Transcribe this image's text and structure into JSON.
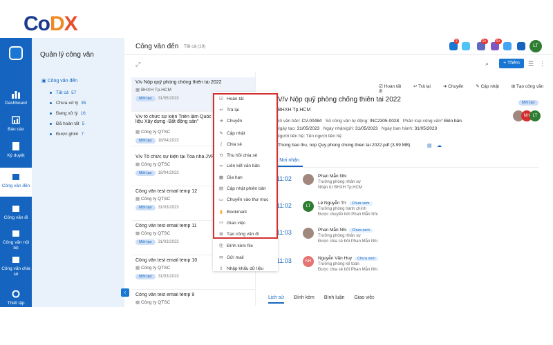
{
  "logo": {
    "c": "C",
    "o": "o",
    "d": "D",
    "x": "X"
  },
  "rail": {
    "items": [
      {
        "label": "Dashboard"
      },
      {
        "label": "Báo cáo"
      },
      {
        "label": "Ký duyệt"
      },
      {
        "label": "Công văn đến"
      },
      {
        "label": "Công văn đi"
      },
      {
        "label": "Công văn nội bộ"
      },
      {
        "label": "Công văn chia sẻ"
      },
      {
        "label": "Thiết lập"
      }
    ]
  },
  "nav": {
    "title": "Quản lý công văn",
    "group": "Công văn đến",
    "subs": [
      {
        "label": "Tất cả",
        "count": "57"
      },
      {
        "label": "Chưa xử lý",
        "count": "35"
      },
      {
        "label": "Đang xử lý",
        "count": "16"
      },
      {
        "label": "Đã hoàn tất",
        "count": "5"
      },
      {
        "label": "Được ghim",
        "count": "7"
      }
    ]
  },
  "header": {
    "title": "Công văn đến",
    "count": "Tất cả (19)",
    "badges": [
      "2",
      "9+",
      "9+"
    ],
    "avatar": "LT",
    "add_label": "+ Thêm"
  },
  "list": [
    {
      "title": "V/v Nộp quỹ phòng chống thiên tai 2022",
      "org": "BHXH Tp.HCM",
      "status": "Mới tạo",
      "date": "31/05/2023"
    },
    {
      "title": "V/v tổ chức sự kiện Triển lãm Quốc tế \"Xây dựng-Vật liệu Xây dựng -Bất động sản\"",
      "org": "Công ty QTSC",
      "status": "Mới tạo",
      "date": "18/04/2023"
    },
    {
      "title": "V/v Tổ chức sự kiện tại Tòa nhà JVPE",
      "org": "Công ty QTSC",
      "status": "Mới tạo",
      "date": "18/04/2023"
    },
    {
      "title": "Công văn test email temp 12",
      "org": "Công ty QTSC",
      "status": "Mới tạo",
      "date": "31/03/2023"
    },
    {
      "title": "Công văn test email temp 11",
      "org": "Công ty QTSC",
      "status": "Mới tạo",
      "date": "31/03/2023"
    },
    {
      "title": "Công văn test email temp 10",
      "org": "Công ty QTSC",
      "status": "Mới tạo",
      "date": "31/03/2023"
    },
    {
      "title": "Công văn test email temp 9",
      "org": "Công ty QTSC",
      "status": "",
      "date": ""
    }
  ],
  "menu": [
    "Hoàn tất",
    "Trả lại",
    "Chuyển",
    "Cập nhật",
    "Chia sẻ",
    "Thu hồi chia sẻ",
    "Liên kết văn bản",
    "Gia hạn",
    "Cập nhật phiên bản",
    "Chuyển vào thư mục",
    "Bookmark",
    "Giao việc",
    "Tạo công văn đi",
    "Đính kèm file",
    "Gửi mail",
    "Nhập khẩu dữ liệu"
  ],
  "toolbar": [
    "Hoàn tất",
    "Trả lại",
    "Chuyển",
    "Cập nhật",
    "Tạo công văn đi"
  ],
  "detail": {
    "title": "V/v Nộp quỹ phòng chống thiên tai 2022",
    "org": "BHXH Tp.HCM",
    "status": "Mới tạo",
    "row1": {
      "a_label": "Số văn bản:",
      "a": "CV-00484",
      "b_label": "Số công văn tự động:",
      "b": "INC2305-0028",
      "c_label": "Phân loại công văn*",
      "c": "Biên bản"
    },
    "row2": {
      "a_label": "Ngày tạo:",
      "a": "31/05/2023",
      "b_label": "Ngày nhận/gửi:",
      "b": "31/05/2023",
      "c_label": "Ngày ban hành:",
      "c": "31/05/2023"
    },
    "row3": "Người liên hệ: Tên người liên hệ",
    "pdf": "Thong bao thu, nop Quy phong chong thien tai 2022.pdf (3.99 MB)",
    "tab": "Nơi nhận",
    "entries": [
      {
        "time": "11:02",
        "name": "Phan Mẫn Nhi",
        "role": "Trưởng phòng nhân sự",
        "note": "Nhận từ BHXH Tp.HCM",
        "avatar": "",
        "tag": ""
      },
      {
        "time": "11:02",
        "name": "Lê Nguyễn Trí",
        "role": "Trưởng phòng hành chính",
        "note": "Được chuyển bởi Phan Mẫn Nhi",
        "avatar": "LT",
        "tag": "Chưa xem"
      },
      {
        "time": "11:03",
        "name": "Phan Mẫn Nhi",
        "role": "Trưởng phòng nhân sự",
        "note": "Được chia sẻ bởi Phan Mẫn Nhi",
        "avatar": "",
        "tag": "Chưa xem"
      },
      {
        "time": "11:03",
        "name": "Nguyễn Văn Huy",
        "role": "Trưởng phòng kế toán",
        "note": "Được chia sẻ bởi Phan Mẫn Nhi",
        "avatar": "NH",
        "tag": "Chưa xem"
      }
    ],
    "bottom_tabs": [
      "Lịch sử",
      "Đính kèm",
      "Bình luận",
      "Giao việc"
    ]
  },
  "colors": {
    "primary": "#1565c0",
    "highlight": "#d32f2f"
  }
}
